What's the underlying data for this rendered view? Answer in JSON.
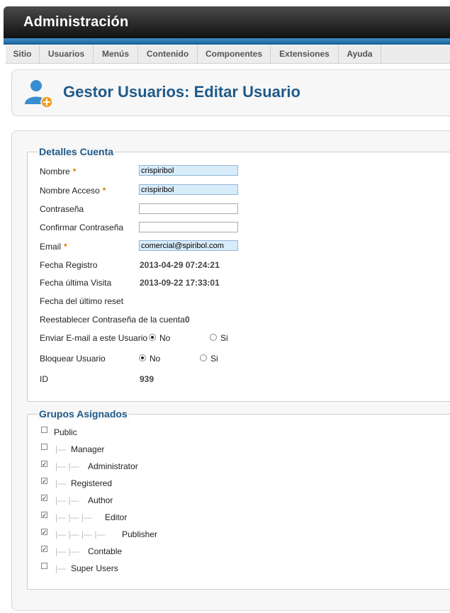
{
  "app": {
    "title": "Administración"
  },
  "menu": {
    "items": [
      "Sitio",
      "Usuarios",
      "Menús",
      "Contenido",
      "Componentes",
      "Extensiones",
      "Ayuda"
    ]
  },
  "page": {
    "title": "Gestor Usuarios: Editar Usuario"
  },
  "account": {
    "legend": "Detalles Cuenta",
    "name_label": "Nombre",
    "name_value": "crispiribol",
    "username_label": "Nombre Acceso",
    "username_value": "crispiribol",
    "password_label": "Contraseña",
    "password_value": "",
    "confirm_label": "Confirmar Contraseña",
    "confirm_value": "",
    "email_label": "Email",
    "email_value": "comercial@spiribol.com",
    "required_mark": "*",
    "register_label": "Fecha Registro",
    "register_value": "2013-04-29 07:24:21",
    "lastvisit_label": "Fecha última Visita",
    "lastvisit_value": "2013-09-22 17:33:01",
    "lastreset_label": "Fecha del último reset",
    "resetcount_label": "Reestablecer Contraseña de la cuenta",
    "resetcount_value": "0",
    "sendemail_label": "Enviar E-mail a este Usuario",
    "block_label": "Bloquear Usuario",
    "opt_no": "No",
    "opt_yes": "Si",
    "id_label": "ID",
    "id_value": "939"
  },
  "groups": {
    "legend": "Grupos Asignados",
    "items": [
      {
        "label": "Public",
        "checked": false,
        "prefix": ""
      },
      {
        "label": "Manager",
        "checked": false,
        "prefix": "|—"
      },
      {
        "label": "Administrator",
        "checked": true,
        "prefix": "|— |—"
      },
      {
        "label": "Registered",
        "checked": true,
        "prefix": "|—"
      },
      {
        "label": "Author",
        "checked": true,
        "prefix": "|— |—"
      },
      {
        "label": "Editor",
        "checked": true,
        "prefix": "|— |— |—"
      },
      {
        "label": "Publisher",
        "checked": true,
        "prefix": "|— |— |— |—"
      },
      {
        "label": "Contable",
        "checked": true,
        "prefix": "|— |—"
      },
      {
        "label": "Super Users",
        "checked": false,
        "prefix": "|—"
      }
    ]
  }
}
